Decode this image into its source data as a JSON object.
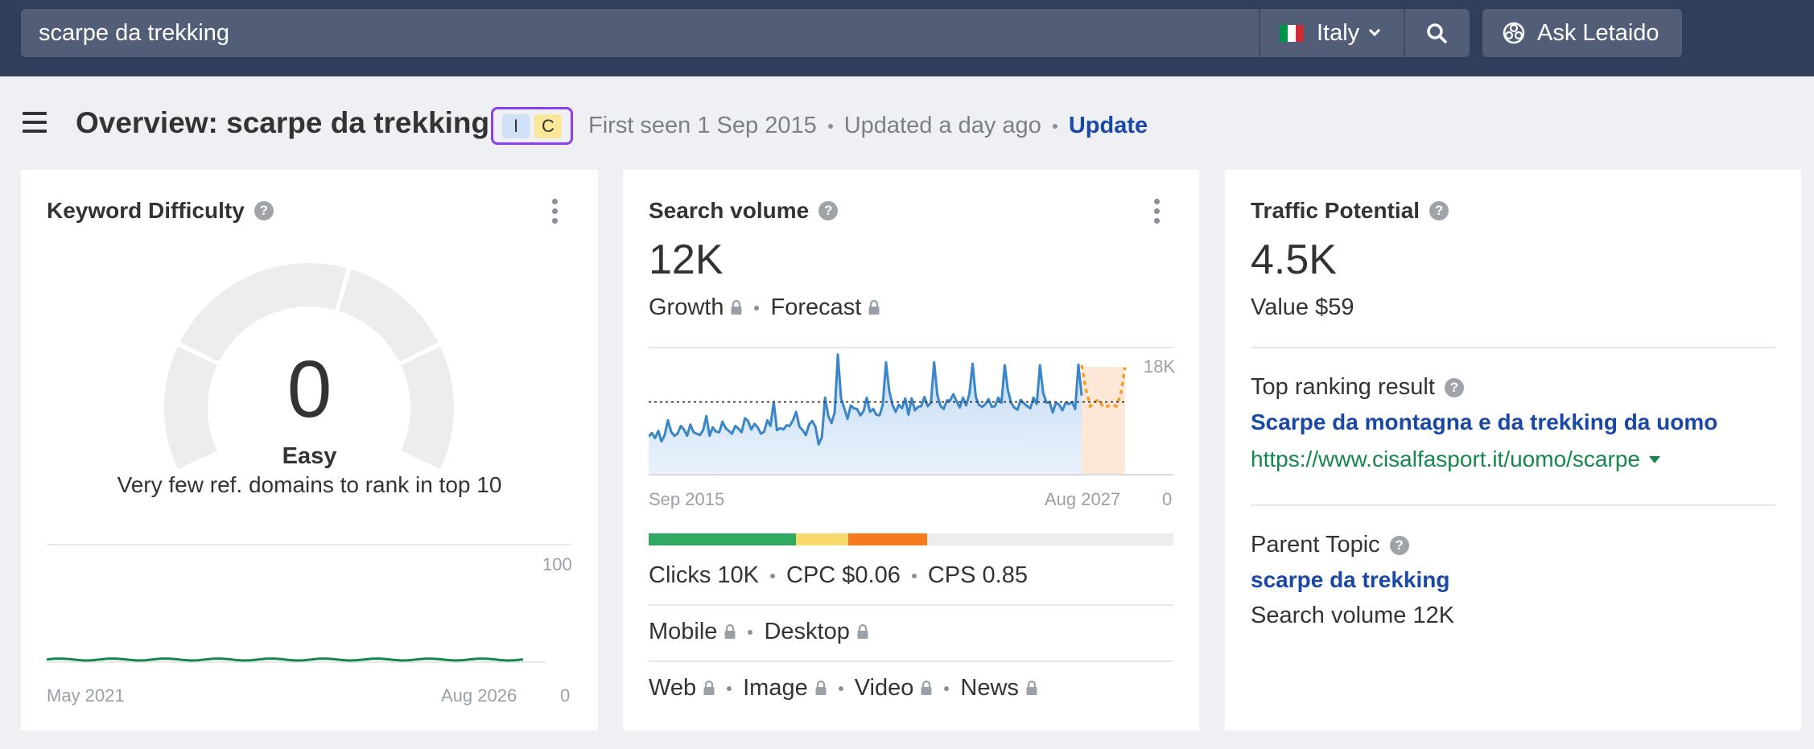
{
  "search": {
    "query": "scarpe da trekking",
    "country": "Italy",
    "ask_label": "Ask Letaido"
  },
  "header": {
    "title": "Overview: scarpe da trekking",
    "intents": [
      "I",
      "C"
    ],
    "first_seen": "First seen 1 Sep 2015",
    "updated": "Updated a day ago",
    "update_label": "Update"
  },
  "colors": {
    "topbar": "#2f3e5a",
    "accent_purple": "#8a3ff0",
    "link_blue": "#1a48a8",
    "link_green": "#14874a",
    "chart_line": "#3a86c8",
    "forecast": "#f39c2a"
  },
  "kd_card": {
    "title": "Keyword Difficulty",
    "value": "0",
    "rating": "Easy",
    "description": "Very few ref. domains to rank in top 10",
    "chart_max": "100",
    "chart_min": "0",
    "x_start": "May 2021",
    "x_end": "Aug 2026"
  },
  "sv_card": {
    "title": "Search volume",
    "value": "12K",
    "growth_label": "Growth",
    "forecast_label": "Forecast",
    "y_max": "18K",
    "y_min": "0",
    "x_start": "Sep 2015",
    "x_end": "Aug 2027",
    "clicks": "Clicks 10K",
    "cpc": "CPC $0.06",
    "cps": "CPS 0.85",
    "mobile_label": "Mobile",
    "desktop_label": "Desktop",
    "web_label": "Web",
    "image_label": "Image",
    "video_label": "Video",
    "news_label": "News",
    "click_bar": [
      {
        "name": "green",
        "fraction": 0.28,
        "color": "#2fa862"
      },
      {
        "name": "yellow",
        "fraction": 0.1,
        "color": "#f5d96b"
      },
      {
        "name": "orange",
        "fraction": 0.15,
        "color": "#f77b1c"
      },
      {
        "name": "grey",
        "fraction": 0.47,
        "color": "#ececec"
      }
    ]
  },
  "tp_card": {
    "title": "Traffic Potential",
    "value": "4.5K",
    "value_line": "Value $59",
    "top_result_label": "Top ranking result",
    "top_result_title": "Scarpe da montagna e da trekking da uomo",
    "top_result_url": "https://www.cisalfasport.it/uomo/scarpe",
    "parent_topic_label": "Parent Topic",
    "parent_topic": "scarpe da trekking",
    "parent_volume": "Search volume 12K"
  },
  "chart_data": [
    {
      "type": "area",
      "title": "Search volume",
      "x": [
        "Sep 2015",
        "Aug 2027"
      ],
      "ylim": [
        0,
        18000
      ],
      "series": [
        {
          "name": "",
          "values": [
            5400,
            5900,
            5200,
            6200,
            4700,
            5600,
            7700,
            6100,
            5500,
            5800,
            6900,
            6400,
            5500,
            7100,
            6000,
            5800,
            5600,
            6300,
            8300,
            5500,
            6700,
            6100,
            6000,
            7500,
            6600,
            6200,
            5800,
            6900,
            6500,
            6000,
            8000,
            7600,
            6400,
            7200,
            6700,
            5800,
            6100,
            7700,
            6900,
            10300,
            6300,
            6600,
            6400,
            7000,
            6900,
            7700,
            8900,
            6800,
            6300,
            5600,
            7100,
            7600,
            6800,
            4300,
            5300,
            10900,
            8300,
            7300,
            8800,
            17000,
            10800,
            9400,
            7900,
            9800,
            9400,
            9300,
            8400,
            9000,
            10900,
            8900,
            9300,
            8500,
            8400,
            9900,
            15900,
            11900,
            9900,
            8900,
            9900,
            9400,
            10800,
            8500,
            10800,
            9100,
            9600,
            9700,
            11000,
            9700,
            10200,
            15900,
            11300,
            9700,
            9300,
            10500,
            10500,
            11400,
            10400,
            9500,
            10900,
            9800,
            11400,
            15700,
            11000,
            9900,
            9600,
            10000,
            10700,
            9600,
            9700,
            10900,
            10200,
            15500,
            12000,
            10200,
            9500,
            9200,
            10600,
            10100,
            9700,
            9400,
            10900,
            10000,
            15500,
            11600,
            10200,
            10300,
            8800,
            10200,
            9900,
            9100,
            10200,
            10000,
            10300,
            9300,
            15600,
            11200
          ]
        },
        {
          "name": "",
          "values": [
            15500,
            12000,
            9700,
            10300,
            10600,
            9500,
            9700,
            9900,
            9700,
            11400,
            15200
          ]
        }
      ]
    },
    {
      "type": "line",
      "title": "Keyword Difficulty",
      "x": [
        "May 2021",
        "Aug 2026"
      ],
      "ylim": [
        0,
        100
      ],
      "series": [
        {
          "name": "",
          "values": [
            1,
            1,
            1,
            1,
            1,
            1,
            1,
            1,
            1,
            1,
            1,
            1,
            1,
            1,
            1,
            1,
            1,
            1,
            1,
            1,
            1,
            1,
            1,
            1,
            1,
            1,
            1,
            1,
            1,
            1,
            1,
            1,
            1,
            1,
            1,
            1,
            1,
            1,
            1,
            1,
            1,
            1,
            1,
            1,
            1,
            1,
            1,
            1,
            1,
            1,
            1,
            1,
            1,
            1,
            1,
            1,
            1,
            1,
            1,
            1,
            1,
            1,
            1,
            1
          ]
        }
      ]
    }
  ]
}
